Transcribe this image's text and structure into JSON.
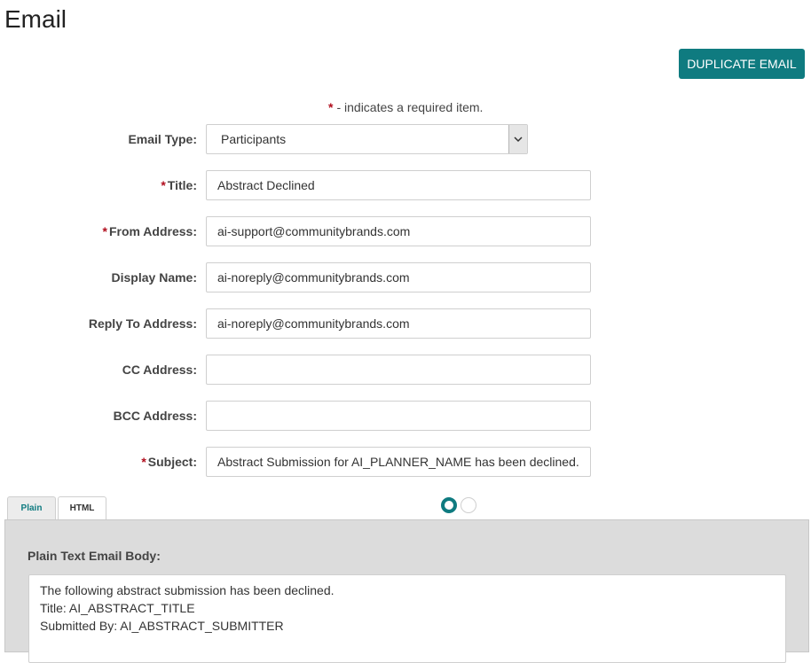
{
  "page": {
    "title": "Email"
  },
  "toolbar": {
    "duplicate_label": "DUPLICATE EMAIL"
  },
  "required_note": {
    "star": "*",
    "text": "- indicates a required item."
  },
  "form": {
    "email_type": {
      "label": "Email Type:",
      "value": "Participants",
      "required": false
    },
    "title": {
      "label": "Title:",
      "value": "Abstract Declined",
      "required": true
    },
    "from_address": {
      "label": "From Address:",
      "value": "ai-support@communitybrands.com",
      "required": true
    },
    "display_name": {
      "label": "Display Name:",
      "value": "ai-noreply@communitybrands.com",
      "required": false
    },
    "reply_to": {
      "label": "Reply To Address:",
      "value": "ai-noreply@communitybrands.com",
      "required": false
    },
    "cc": {
      "label": "CC Address:",
      "value": "",
      "required": false
    },
    "bcc": {
      "label": "BCC Address:",
      "value": "",
      "required": false
    },
    "subject": {
      "label": "Subject:",
      "value": "Abstract Submission for AI_PLANNER_NAME has been declined.",
      "required": true
    },
    "required_star": "*"
  },
  "tabs": [
    {
      "label": "Plain",
      "active": true
    },
    {
      "label": "HTML",
      "active": false
    }
  ],
  "body": {
    "label": "Plain Text Email Body:",
    "lines": [
      "The following abstract submission has been declined.",
      "Title: AI_ABSTRACT_TITLE",
      "Submitted By: AI_ABSTRACT_SUBMITTER"
    ]
  },
  "colors": {
    "accent": "#0f7b80",
    "required": "#b10e1e",
    "panel": "#dcdcdc"
  }
}
